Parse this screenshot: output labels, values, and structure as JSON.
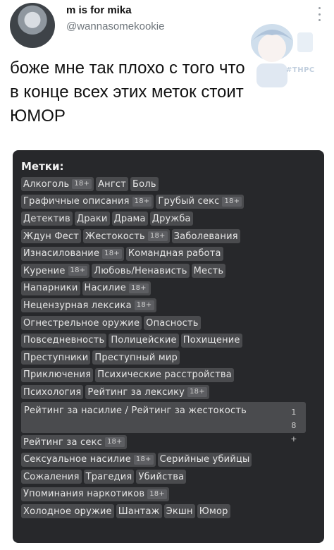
{
  "user": {
    "name": "m is for mika",
    "handle": "@wannasomekookie"
  },
  "sticker": {
    "watermark": "#THPC"
  },
  "tweet": {
    "lines": [
      "боже мне так плохо с того что",
      "в конце всех этих меток стоит",
      "ЮМОР"
    ]
  },
  "card": {
    "title": "Метки:",
    "rows": [
      [
        {
          "label": "Алкоголь",
          "badge": "18+"
        },
        {
          "label": "Ангст"
        },
        {
          "label": "Боль"
        }
      ],
      [
        {
          "label": "Графичные описания",
          "badge": "18+"
        },
        {
          "label": "Грубый секс",
          "badge": "18+"
        }
      ],
      [
        {
          "label": "Детектив"
        },
        {
          "label": "Драки"
        },
        {
          "label": "Драма"
        },
        {
          "label": "Дружба"
        }
      ],
      [
        {
          "label": "Ждун Фест"
        },
        {
          "label": "Жестокость",
          "badge": "18+"
        },
        {
          "label": "Заболевания"
        }
      ],
      [
        {
          "label": "Изнасилование",
          "badge": "18+"
        },
        {
          "label": "Командная работа"
        }
      ],
      [
        {
          "label": "Курение",
          "badge": "18+"
        },
        {
          "label": "Любовь/Ненависть"
        },
        {
          "label": "Месть"
        }
      ],
      [
        {
          "label": "Напарники"
        },
        {
          "label": "Насилие",
          "badge": "18+"
        }
      ],
      [
        {
          "label": "Нецензурная лексика",
          "badge": "18+"
        }
      ],
      [
        {
          "label": "Огнестрельное оружие"
        },
        {
          "label": "Опасность"
        }
      ],
      [
        {
          "label": "Повседневность"
        },
        {
          "label": "Полицейские"
        },
        {
          "label": "Похищение"
        }
      ],
      [
        {
          "label": "Преступники"
        },
        {
          "label": "Преступный мир"
        }
      ],
      [
        {
          "label": "Приключения"
        },
        {
          "label": "Психические расстройства"
        }
      ],
      [
        {
          "label": "Психология"
        },
        {
          "label": "Рейтинг за лексику",
          "badge": "18+"
        }
      ],
      [
        {
          "label": "Рейтинг за насилие / Рейтинг за жестокость",
          "badge": "18+",
          "wide": true
        }
      ],
      [
        {
          "label": "Рейтинг за секс",
          "badge": "18+"
        }
      ],
      [
        {
          "label": "Сексуальное насилие",
          "badge": "18+"
        },
        {
          "label": "Серийные убийцы"
        }
      ],
      [
        {
          "label": "Сожаления"
        },
        {
          "label": "Трагедия"
        },
        {
          "label": "Убийства"
        }
      ],
      [
        {
          "label": "Упоминания наркотиков",
          "badge": "18+"
        }
      ],
      [
        {
          "label": "Холодное оружие"
        },
        {
          "label": "Шантаж"
        },
        {
          "label": "Экшн"
        },
        {
          "label": "Юмор"
        }
      ]
    ]
  },
  "colors": {
    "card_bg": "#27282b",
    "tag_bg": "#4a4b4e",
    "tag_text": "#e6e6e6",
    "handle": "#6f767c"
  }
}
